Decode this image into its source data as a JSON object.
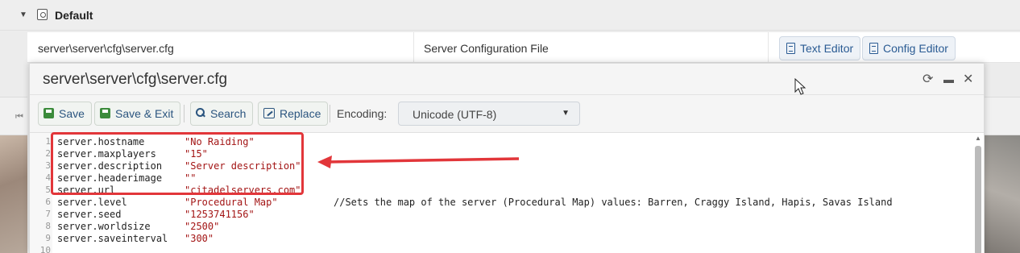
{
  "group": {
    "title": "Default"
  },
  "file_row": {
    "path": "server\\server\\cfg\\server.cfg",
    "description": "Server Configuration File",
    "text_editor_label": "Text Editor",
    "config_editor_label": "Config Editor"
  },
  "dialog": {
    "title": "server\\server\\cfg\\server.cfg",
    "toolbar": {
      "save_label": "Save",
      "save_exit_label": "Save & Exit",
      "search_label": "Search",
      "replace_label": "Replace",
      "encoding_label": "Encoding:",
      "encoding_value": "Unicode (UTF-8)"
    }
  },
  "editor": {
    "lines": [
      {
        "num": "1",
        "key": "server.hostname",
        "value": "\"No Raiding\"",
        "comment": ""
      },
      {
        "num": "2",
        "key": "server.maxplayers",
        "value": "\"15\"",
        "comment": ""
      },
      {
        "num": "3",
        "key": "server.description",
        "value": "\"Server description\"",
        "comment": ""
      },
      {
        "num": "4",
        "key": "server.headerimage",
        "value": "\"\"",
        "comment": ""
      },
      {
        "num": "5",
        "key": "server.url",
        "value": "\"citadelservers.com\"",
        "comment": ""
      },
      {
        "num": "6",
        "key": "server.level",
        "value": "\"Procedural Map\"",
        "comment": "//Sets the map of the server (Procedural Map) values: Barren, Craggy Island, Hapis, Savas Island"
      },
      {
        "num": "7",
        "key": "server.seed",
        "value": "\"1253741156\"",
        "comment": ""
      },
      {
        "num": "8",
        "key": "server.worldsize",
        "value": "\"2500\"",
        "comment": ""
      },
      {
        "num": "9",
        "key": "server.saveinterval",
        "value": "\"300\"",
        "comment": ""
      },
      {
        "num": "10",
        "key": "",
        "value": "",
        "comment": ""
      }
    ]
  },
  "colors": {
    "annotation": "#e2363a",
    "string_value": "#a31515",
    "accent": "#2b557f"
  }
}
